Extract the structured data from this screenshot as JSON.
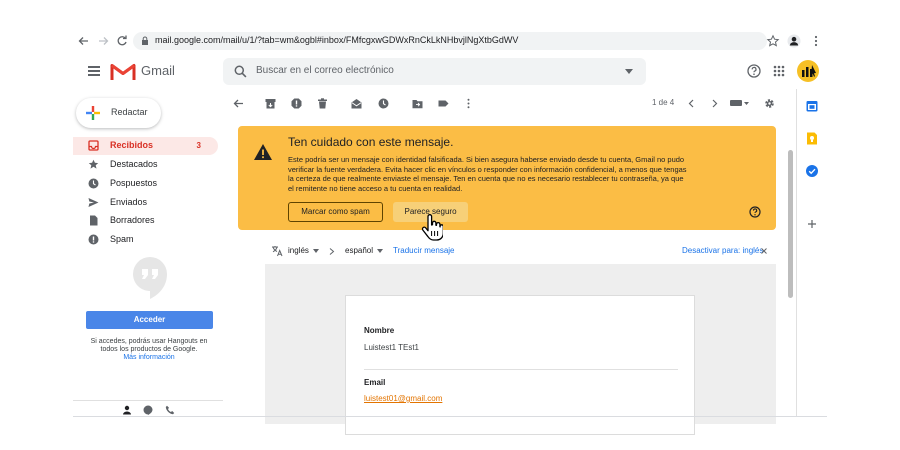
{
  "browser": {
    "url": "mail.google.com/mail/u/1/?tab=wm&ogbl#inbox/FMfcgxwGDWxRnCkLkNHbvjlNgXtbGdWV"
  },
  "header": {
    "brand": "Gmail",
    "search_placeholder": "Buscar en el correo electrónico"
  },
  "sidebar": {
    "compose_label": "Redactar",
    "items": [
      {
        "label": "Recibidos",
        "count": "3",
        "icon": "inbox-icon"
      },
      {
        "label": "Destacados",
        "icon": "star-icon"
      },
      {
        "label": "Pospuestos",
        "icon": "clock-icon"
      },
      {
        "label": "Enviados",
        "icon": "send-icon"
      },
      {
        "label": "Borradores",
        "icon": "draft-icon"
      },
      {
        "label": "Spam",
        "icon": "report-icon"
      }
    ],
    "hangouts": {
      "accept_label": "Acceder",
      "hint_line1": "Si accedes, podrás usar Hangouts en",
      "hint_line2": "todos los productos de Google.",
      "more_info": "Más información"
    }
  },
  "toolbar": {
    "page_count": "1 de 4"
  },
  "warning": {
    "title": "Ten cuidado con este mensaje.",
    "body": "Este podría ser un mensaje con identidad falsificada. Si bien asegura haberse enviado desde tu cuenta, Gmail no pudo verificar la fuente verdadera. Evita hacer clic en vínculos o responder con información confidencial, a menos que tengas la certeza de que realmente enviaste el mensaje. Ten en cuenta que no es necesario restablecer tu contraseña, ya que el remitente no tiene acceso a tu cuenta en realidad.",
    "spam_button": "Marcar como spam",
    "safe_button": "Parece seguro"
  },
  "translate": {
    "from_lang": "inglés",
    "to_lang": "español",
    "translate_link": "Traducir mensaje",
    "disable_link": "Desactivar para: inglés"
  },
  "message": {
    "name_label": "Nombre",
    "name_value": "Luistest1 TEst1",
    "email_label": "Email",
    "email_value": "luistest01@gmail.com"
  },
  "colors": {
    "warning_bg": "#fbbd45",
    "accent_red": "#d93025",
    "link_blue": "#1a73e8"
  }
}
